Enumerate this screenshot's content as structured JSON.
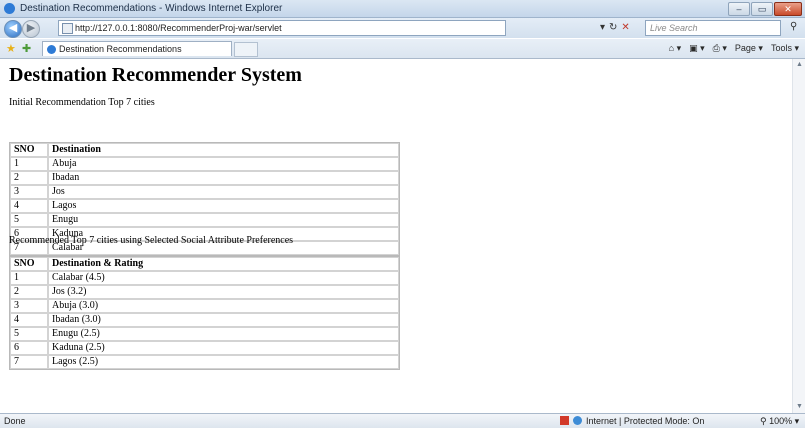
{
  "window": {
    "title": "Destination Recommendations - Windows Internet Explorer",
    "buttons": {
      "min": "–",
      "max": "▭",
      "close": "✕"
    }
  },
  "address_bar": {
    "url": "http://127.0.0.1:8080/RecommenderProj-war/servlet",
    "search_placeholder": "Live Search"
  },
  "tab": {
    "label": "Destination Recommendations"
  },
  "commands": {
    "page": "Page",
    "tools": "Tools"
  },
  "page": {
    "heading": "Destination Recommender System",
    "intro_initial": "Initial Recommendation Top 7 cities",
    "table1": {
      "headers": [
        "SNO",
        "Destination"
      ],
      "rows": [
        [
          "1",
          "Abuja"
        ],
        [
          "2",
          "Ibadan"
        ],
        [
          "3",
          "Jos"
        ],
        [
          "4",
          "Lagos"
        ],
        [
          "5",
          "Enugu"
        ],
        [
          "6",
          "Kaduna"
        ],
        [
          "7",
          "Calabar"
        ]
      ]
    },
    "intro_recommended": "Recommended Top 7 cities using Selected Social Attribute Preferences",
    "table2": {
      "headers": [
        "SNO",
        "Destination & Rating"
      ],
      "rows": [
        [
          "1",
          "Calabar (4.5)"
        ],
        [
          "2",
          "Jos (3.2)"
        ],
        [
          "3",
          "Abuja (3.0)"
        ],
        [
          "4",
          "Ibadan (3.0)"
        ],
        [
          "5",
          "Enugu (2.5)"
        ],
        [
          "6",
          "Kaduna (2.5)"
        ],
        [
          "7",
          "Lagos (2.5)"
        ]
      ]
    }
  },
  "status": {
    "left": "Done",
    "zone": "Internet | Protected Mode: On",
    "zoom": "100%"
  }
}
